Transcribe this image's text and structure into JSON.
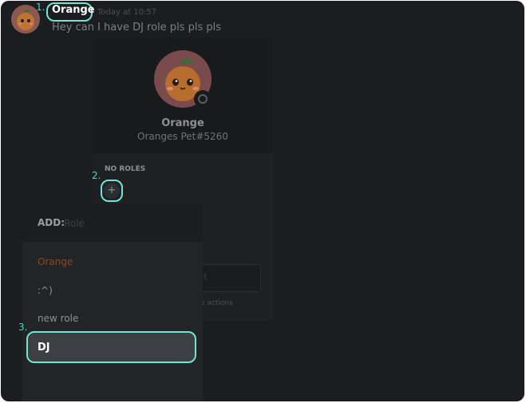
{
  "message": {
    "username": "Orange",
    "timestamp": "Today at 10:57",
    "text": "Hey can I have DJ role pls pls pls"
  },
  "profile": {
    "name": "Orange",
    "tag": "Oranges Pet#5260",
    "roles_heading": "NO ROLES",
    "add_role_symbol": "+",
    "note_placeholder": "et",
    "more_actions": "ore actions"
  },
  "role_picker": {
    "label": "ADD:",
    "search_placeholder": "Role",
    "roles": [
      {
        "name": "Orange",
        "color": "#8a4a24"
      },
      {
        "name": ":^)",
        "color": "#8d9096"
      },
      {
        "name": "new role",
        "color": "#8d9096"
      },
      {
        "name": "DJ",
        "color": "#ffffff"
      }
    ],
    "selected_index": 3
  },
  "steps": [
    "1.",
    "2.",
    "3."
  ],
  "colors": {
    "highlight": "#6ee6d2",
    "step_number": "#4fd6bd",
    "background": "#1c1d20"
  }
}
